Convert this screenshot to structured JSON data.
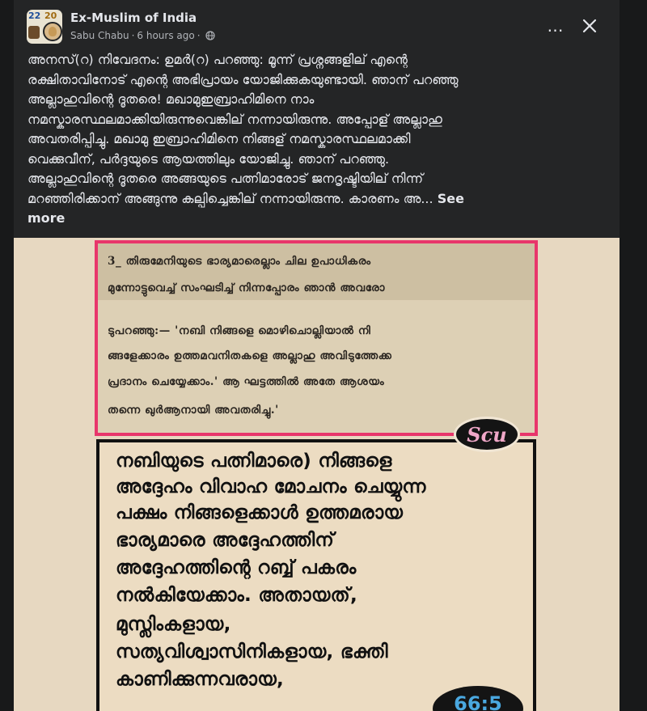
{
  "post": {
    "page_name": "Ex-Muslim of India",
    "author": "Sabu Chabu",
    "time": "6 hours ago",
    "separator": "·",
    "more_icon": "…",
    "close_icon": "close-icon",
    "text_lines": [
      "അനസ്(റ) നിവേദനം: ഉമർ(റ) പറഞ്ഞു: മൂന്ന് പ്രശ്നങ്ങളില് എന്റെ",
      "രക്ഷിതാവിനോട് എന്റെ അഭിപ്രായം യോജിക്കുകയുണ്ടായി. ഞാന് പറഞ്ഞു",
      "അല്ലാഹുവിന്റെ ദൂതരെ! മഖാമുഇബ്രാഹിമിനെ നാം",
      "നമസ്കാരസ്ഥലമാക്കിയിരുന്നുവെങ്കില് നന്നായിരുന്നു. അപ്പോള് അല്ലാഹു",
      "അവതരിപ്പിച്ചു. മഖാമു ഇബ്രാഹിമിനെ നിങ്ങള് നമസ്കാരസ്ഥലമാക്കി",
      "വെക്കുവീന്, പർദ്ദയുടെ ആയത്തിലും യോജിച്ചു. ഞാന് പറഞ്ഞു.",
      "അല്ലാഹുവിന്റെ ദൂതരെ അങ്ങയുടെ പത്നിമാരോട് ജനദൃഷ്ടിയില് നിന്ന്",
      "മറഞ്ഞിരിക്കാന് അങ്ങുന്നു കല്പിച്ചെങ്കില് നന്നായിരുന്നു. കാരണം അ..."
    ],
    "see_more_1": "See",
    "see_more_2": "more"
  },
  "image": {
    "clipping_lines": [
      "3_  തിരുമേനിയുടെ ഭാര്യമാരെല്ലാം ചില ഉപാധികരം",
      "മുന്നോട്ടുവെച്ച് സംഘടിച്ച് നിന്നപ്പോരം ഞാൻ അവരോ",
      "ടുപറഞ്ഞു:— 'നബി നിങ്ങളെ മൊഴിചൊല്ലിയാൽ നി",
      "ങ്ങളേക്കാരം ഉത്തമവനിതകളെ അല്ലാഹു അവിടുത്തേക്ക",
      "പ്രദാനം ചെയ്യേക്കാം.' ആ ഘട്ടത്തിൽ അതേ ആശയം",
      "തന്നെ ഖുർആനായി അവതരിച്ചു.'"
    ],
    "watermark": "Scu",
    "quote_lines": [
      "നബിയുടെ പത്നിമാരെ) നിങ്ങളെ",
      "അദ്ദേഹം വിവാഹ മോചനം ചെയ്യുന്ന",
      "പക്ഷം നിങ്ങളെക്കാൾ ഉത്തമരായ",
      "ഭാര്യമാരെ അദ്ദേഹത്തിന്",
      "അദ്ദേഹത്തിന്റെ റബ്ബ് പകരം",
      "നൽകിയേക്കാം. അതായത്,",
      "മുസ്ലിംകളായ,",
      "സത്യവിശ്വാസിനികളായ, ഭക്തി",
      "കാണിക്കുന്നവരായ,"
    ],
    "verse_ref": "66:5"
  },
  "avatar": {
    "text_left": "22",
    "text_right": "20"
  },
  "colors": {
    "background": "#18191a",
    "card": "#242526",
    "text": "#e4e6eb",
    "secondary_text": "#b0b3b8",
    "clip_border": "#e8366b",
    "verse_text": "#4aa8e0"
  }
}
